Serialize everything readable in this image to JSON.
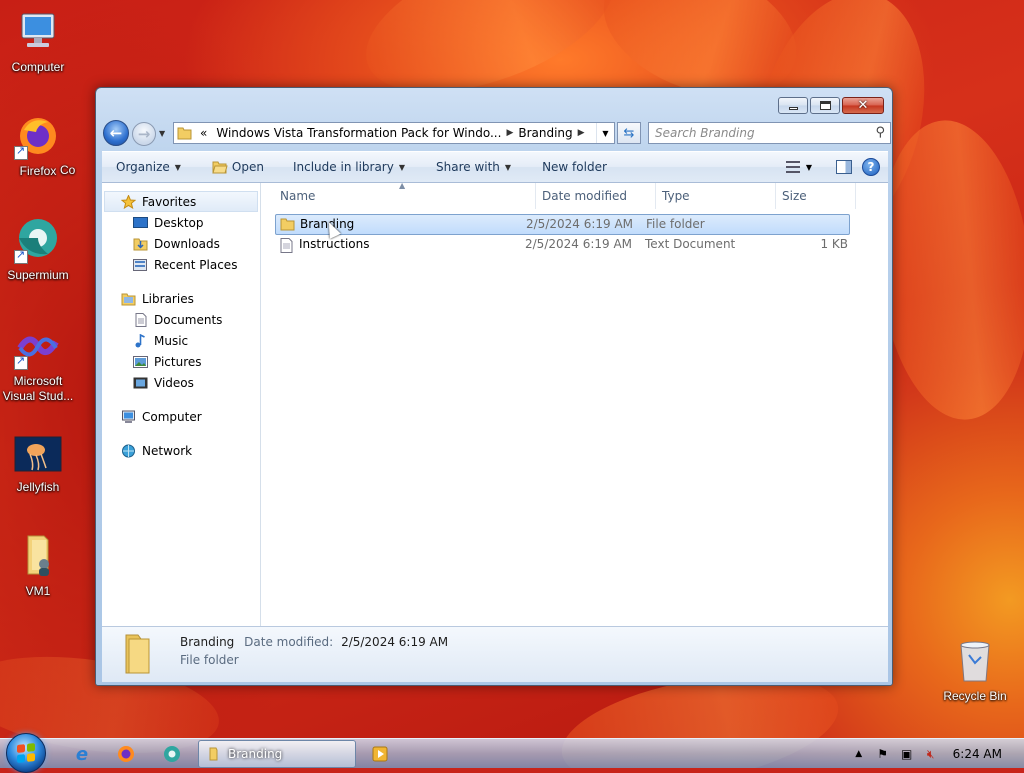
{
  "desktop": {
    "icons": [
      {
        "label": "Computer",
        "icon": "computer-icon"
      },
      {
        "label": "Firefox",
        "icon": "firefox-icon"
      },
      {
        "label": "Supermium",
        "icon": "supermium-icon"
      },
      {
        "label": "Microsoft Visual Stud...",
        "icon": "visual-studio-icon"
      },
      {
        "label": "Jellyfish",
        "icon": "image-icon"
      },
      {
        "label": "VM1",
        "icon": "folder-user-icon"
      },
      {
        "label": "Recycle Bin",
        "icon": "recycle-bin-icon"
      }
    ],
    "partial_label": "Co"
  },
  "explorer": {
    "address": {
      "overflow": "«",
      "crumbs": [
        "Windows Vista Transformation Pack for Windo...",
        "Branding"
      ]
    },
    "search_placeholder": "Search Branding",
    "toolbar": {
      "organize": "Organize",
      "open": "Open",
      "include_in_library": "Include in library",
      "share_with": "Share with",
      "new_folder": "New folder"
    },
    "nav": {
      "favorites": {
        "label": "Favorites",
        "items": [
          "Desktop",
          "Downloads",
          "Recent Places"
        ]
      },
      "libraries": {
        "label": "Libraries",
        "items": [
          "Documents",
          "Music",
          "Pictures",
          "Videos"
        ]
      },
      "computer": "Computer",
      "network": "Network"
    },
    "columns": [
      "Name",
      "Date modified",
      "Type",
      "Size"
    ],
    "files": [
      {
        "name": "Branding",
        "date": "2/5/2024 6:19 AM",
        "type": "File folder",
        "size": "",
        "icon": "folder-icon",
        "selected": true
      },
      {
        "name": "Instructions",
        "date": "2/5/2024 6:19 AM",
        "type": "Text Document",
        "size": "1 KB",
        "icon": "text-document-icon",
        "selected": false
      }
    ],
    "details": {
      "name": "Branding",
      "date_label": "Date modified:",
      "date_value": "2/5/2024 6:19 AM",
      "type": "File folder"
    }
  },
  "taskbar": {
    "active_window": "Branding",
    "clock": "6:24 AM"
  },
  "colors": {
    "selection": "#c1dcfc",
    "toolbar_text": "#1e395b",
    "window_frame": "#aac6e6"
  }
}
